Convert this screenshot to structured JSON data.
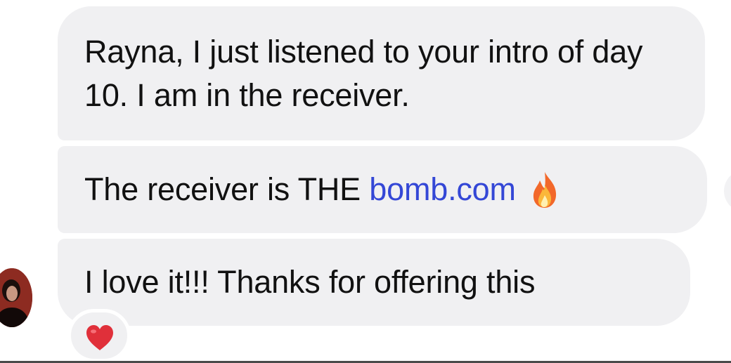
{
  "messages": [
    {
      "text": "Rayna, I just listened to your intro of day 10. I am in the receiver."
    },
    {
      "text_before": "The receiver is THE ",
      "link": "bomb.com",
      "emoji": "fire-icon"
    },
    {
      "text": "I love it!!! Thanks for offering this",
      "reaction": "heart-icon"
    }
  ],
  "colors": {
    "bubble_background": "#f0f0f2",
    "link": "#3447d6",
    "heart": "#e0303a"
  }
}
